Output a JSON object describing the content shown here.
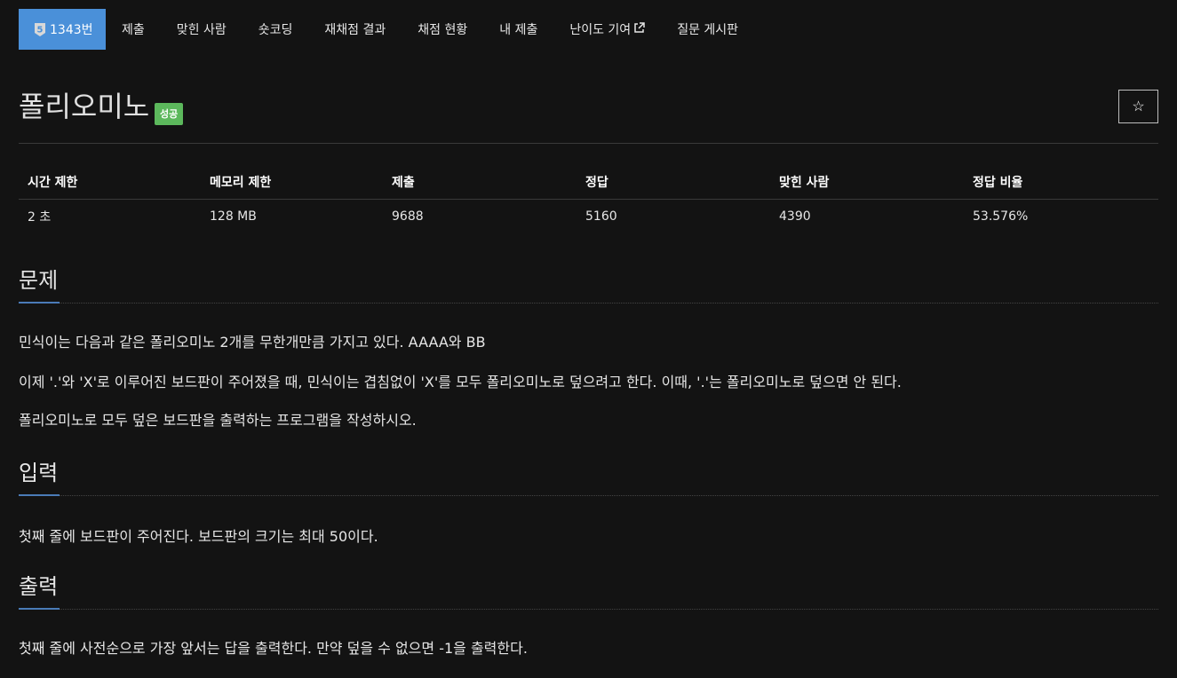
{
  "nav": {
    "problem_badge_tier": "5",
    "problem_number": "1343번",
    "items": [
      "제출",
      "맞힌 사람",
      "숏코딩",
      "재채점 결과",
      "채점 현황",
      "내 제출",
      "난이도 기여",
      "질문 게시판"
    ]
  },
  "problem": {
    "title": "폴리오미노",
    "status": "성공",
    "star_symbol": "☆"
  },
  "stats": {
    "headers": [
      "시간 제한",
      "메모리 제한",
      "제출",
      "정답",
      "맞힌 사람",
      "정답 비율"
    ],
    "values": [
      "2 초",
      "128 MB",
      "9688",
      "5160",
      "4390",
      "53.576%"
    ]
  },
  "sections": {
    "description": {
      "title": "문제",
      "paragraphs": [
        "민식이는 다음과 같은 폴리오미노 2개를 무한개만큼 가지고 있다. AAAA와 BB",
        "이제 '.'와 'X'로 이루어진 보드판이 주어졌을 때, 민식이는 겹침없이 'X'를 모두 폴리오미노로 덮으려고 한다. 이때, '.'는 폴리오미노로 덮으면 안 된다.",
        "폴리오미노로 모두 덮은 보드판을 출력하는 프로그램을 작성하시오."
      ]
    },
    "input": {
      "title": "입력",
      "paragraphs": [
        "첫째 줄에 보드판이 주어진다. 보드판의 크기는 최대 50이다."
      ]
    },
    "output": {
      "title": "출력",
      "paragraphs": [
        "첫째 줄에 사전순으로 가장 앞서는 답을 출력한다. 만약 덮을 수 없으면 -1을 출력한다."
      ]
    }
  },
  "colors": {
    "background": "#131313",
    "nav_active": "#4a90d9",
    "success": "#5cb85c",
    "section_accent": "#4a7bb7"
  }
}
